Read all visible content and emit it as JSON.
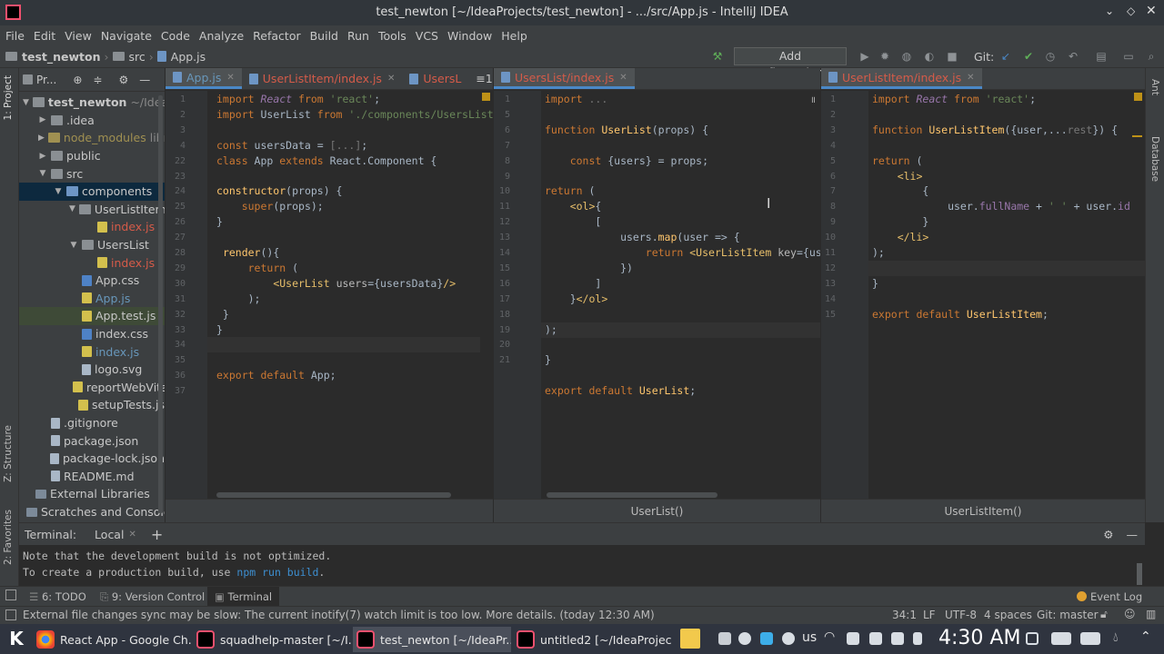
{
  "window": {
    "title": "test_newton [~/IdeaProjects/test_newton] - .../src/App.js - IntelliJ IDEA"
  },
  "menu": [
    "File",
    "Edit",
    "View",
    "Navigate",
    "Code",
    "Analyze",
    "Refactor",
    "Build",
    "Run",
    "Tools",
    "VCS",
    "Window",
    "Help"
  ],
  "breadcrumb": {
    "project": "test_newton",
    "folder": "src",
    "file": "App.js"
  },
  "toolbar": {
    "run_config": "Add Configuration...",
    "git_label": "Git:"
  },
  "left_tools": {
    "project": "1: Project",
    "structure": "Z: Structure",
    "favorites": "2: Favorites"
  },
  "right_tools": {
    "ant": "Ant",
    "database": "Database"
  },
  "project": {
    "title": "Pr...",
    "items": [
      {
        "name": "test_newton",
        "suffix": "~/IdeaP",
        "depth": 0,
        "icon": "folder",
        "open": true,
        "bold": true
      },
      {
        "name": ".idea",
        "depth": 1,
        "icon": "folder",
        "open": false
      },
      {
        "name": "node_modules",
        "suffix": "libr",
        "depth": 1,
        "icon": "folder-yellow",
        "open": false,
        "style": "yellow"
      },
      {
        "name": "public",
        "depth": 1,
        "icon": "folder",
        "open": false
      },
      {
        "name": "src",
        "depth": 1,
        "icon": "folder",
        "open": true
      },
      {
        "name": "components",
        "depth": 2,
        "icon": "folder-blue",
        "open": true,
        "selected": true
      },
      {
        "name": "UserListItem",
        "depth": 3,
        "icon": "folder",
        "open": true
      },
      {
        "name": "index.js",
        "depth": 4,
        "icon": "js",
        "style": "red"
      },
      {
        "name": "UsersList",
        "depth": 3,
        "icon": "folder",
        "open": true
      },
      {
        "name": "index.js",
        "depth": 4,
        "icon": "js",
        "style": "red"
      },
      {
        "name": "App.css",
        "depth": 3,
        "icon": "css"
      },
      {
        "name": "App.js",
        "depth": 3,
        "icon": "js",
        "style": "blue"
      },
      {
        "name": "App.test.js",
        "depth": 3,
        "icon": "js",
        "highlight": true
      },
      {
        "name": "index.css",
        "depth": 3,
        "icon": "css"
      },
      {
        "name": "index.js",
        "depth": 3,
        "icon": "js",
        "style": "blue"
      },
      {
        "name": "logo.svg",
        "depth": 3,
        "icon": "file"
      },
      {
        "name": "reportWebVitals",
        "depth": 3,
        "icon": "js"
      },
      {
        "name": "setupTests.js",
        "depth": 3,
        "icon": "js"
      },
      {
        "name": ".gitignore",
        "depth": 1,
        "icon": "file"
      },
      {
        "name": "package.json",
        "depth": 1,
        "icon": "file"
      },
      {
        "name": "package-lock.json",
        "depth": 1,
        "icon": "file"
      },
      {
        "name": "README.md",
        "depth": 1,
        "icon": "file"
      },
      {
        "name": "External Libraries",
        "depth": 0,
        "icon": "lib"
      },
      {
        "name": "Scratches and Console",
        "depth": 0,
        "icon": "lib"
      }
    ]
  },
  "editor1": {
    "tabs": [
      "App.js",
      "UserListItem/index.js",
      "UsersL"
    ],
    "tab_overflow": "≡1",
    "lines": [
      "1",
      "2",
      "3",
      "4",
      "22",
      "23",
      "24",
      "25",
      "26",
      "27",
      "28",
      "29",
      "30",
      "31",
      "32",
      "33",
      "34",
      "35",
      "36",
      "37"
    ],
    "code": [
      [
        {
          "c": "kw",
          "t": "import "
        },
        {
          "c": "it",
          "t": "React"
        },
        {
          "c": "kw",
          "t": " from "
        },
        {
          "c": "str",
          "t": "'react'"
        },
        {
          "t": ";"
        }
      ],
      [
        {
          "c": "kw",
          "t": "import "
        },
        {
          "t": "UserList "
        },
        {
          "c": "kw",
          "t": "from "
        },
        {
          "c": "str",
          "t": "'./components/UsersList'"
        },
        {
          "t": ";"
        }
      ],
      [],
      [
        {
          "c": "kw",
          "t": "const "
        },
        {
          "t": "usersData = "
        },
        {
          "c": "dim",
          "t": "[...]"
        },
        {
          "t": ";"
        }
      ],
      [
        {
          "c": "kw",
          "t": "class "
        },
        {
          "t": "App "
        },
        {
          "c": "kw",
          "t": "extends "
        },
        {
          "t": "React.Component {"
        }
      ],
      [],
      [
        {
          "c": "fn",
          "t": "constructor"
        },
        {
          "t": "(props) {"
        }
      ],
      [
        {
          "t": "    "
        },
        {
          "c": "kw",
          "t": "super"
        },
        {
          "t": "(props);"
        }
      ],
      [
        {
          "t": "}"
        }
      ],
      [],
      [
        {
          "t": " "
        },
        {
          "c": "fn",
          "t": "render"
        },
        {
          "t": "(){"
        }
      ],
      [
        {
          "t": "     "
        },
        {
          "c": "kw",
          "t": "return "
        },
        {
          "t": "("
        }
      ],
      [
        {
          "t": "         "
        },
        {
          "c": "tag",
          "t": "<UserList "
        },
        {
          "c": "attr",
          "t": "users"
        },
        {
          "t": "={usersData}"
        },
        {
          "c": "tag",
          "t": "/>"
        }
      ],
      [
        {
          "t": "     );"
        }
      ],
      [
        {
          "t": " }"
        }
      ],
      [
        {
          "t": "}"
        }
      ],
      [],
      [],
      [
        {
          "c": "kw",
          "t": "export default "
        },
        {
          "t": "App;"
        }
      ],
      []
    ]
  },
  "editor2": {
    "tab": "UsersList/index.js",
    "lines": [
      "1",
      "5",
      "6",
      "7",
      "8",
      "9",
      "10",
      "11",
      "12",
      "13",
      "14",
      "15",
      "16",
      "17",
      "18",
      "19",
      "20",
      "21"
    ],
    "code": [
      [
        {
          "c": "kw",
          "t": "import "
        },
        {
          "c": "dim",
          "t": "..."
        }
      ],
      [],
      [
        {
          "c": "kw",
          "t": "function "
        },
        {
          "c": "fn",
          "t": "UserList"
        },
        {
          "t": "(props) {"
        }
      ],
      [],
      [
        {
          "t": "    "
        },
        {
          "c": "kw",
          "t": "const "
        },
        {
          "t": "{users} = props;"
        }
      ],
      [],
      [
        {
          "c": "kw",
          "t": "return "
        },
        {
          "t": "("
        }
      ],
      [
        {
          "t": "    "
        },
        {
          "c": "tag",
          "t": "<ol>"
        },
        {
          "t": "{"
        }
      ],
      [
        {
          "t": "        ["
        }
      ],
      [
        {
          "t": "            users."
        },
        {
          "c": "fn",
          "t": "map"
        },
        {
          "t": "(user => {"
        }
      ],
      [
        {
          "t": "                "
        },
        {
          "c": "kw",
          "t": "return "
        },
        {
          "c": "tag",
          "t": "<UserListItem "
        },
        {
          "c": "attr",
          "t": "key"
        },
        {
          "t": "={user"
        }
      ],
      [
        {
          "t": "            })"
        }
      ],
      [
        {
          "t": "        ]"
        }
      ],
      [
        {
          "t": "    }"
        },
        {
          "c": "tag",
          "t": "</ol>"
        }
      ],
      [],
      [
        {
          "t": ");"
        }
      ],
      [],
      [
        {
          "t": "}"
        }
      ],
      [],
      [
        {
          "c": "kw",
          "t": "export default "
        },
        {
          "c": "fn",
          "t": "UserList"
        },
        {
          "t": ";"
        }
      ]
    ],
    "crumb": "UserList()"
  },
  "editor3": {
    "tab": "UserListItem/index.js",
    "lines": [
      "1",
      "2",
      "3",
      "4",
      "5",
      "6",
      "7",
      "8",
      "9",
      "10",
      "11",
      "12",
      "13",
      "14",
      "15"
    ],
    "code": [
      [
        {
          "c": "kw",
          "t": "import "
        },
        {
          "c": "it",
          "t": "React"
        },
        {
          "c": "kw",
          "t": " from "
        },
        {
          "c": "str",
          "t": "'react'"
        },
        {
          "t": ";"
        }
      ],
      [],
      [
        {
          "c": "kw",
          "t": "function "
        },
        {
          "c": "fn",
          "t": "UserListItem"
        },
        {
          "t": "({user,..."
        },
        {
          "c": "dim",
          "t": "rest"
        },
        {
          "t": "}) {"
        }
      ],
      [],
      [
        {
          "c": "kw",
          "t": "return "
        },
        {
          "t": "("
        }
      ],
      [
        {
          "t": "    "
        },
        {
          "c": "tag",
          "t": "<li>"
        }
      ],
      [
        {
          "t": "        {"
        }
      ],
      [
        {
          "t": "            user."
        },
        {
          "c": "pur",
          "t": "fullName"
        },
        {
          "t": " + "
        },
        {
          "c": "str",
          "t": "' '"
        },
        {
          "t": " + user."
        },
        {
          "c": "pur",
          "t": "id"
        }
      ],
      [
        {
          "t": "        }"
        }
      ],
      [
        {
          "t": "    "
        },
        {
          "c": "tag",
          "t": "</li>"
        }
      ],
      [
        {
          "t": ");"
        }
      ],
      [],
      [
        {
          "t": "}"
        }
      ],
      [],
      [
        {
          "c": "kw",
          "t": "export default "
        },
        {
          "c": "fn",
          "t": "UserListItem"
        },
        {
          "t": ";"
        }
      ]
    ],
    "crumb": "UserListItem()"
  },
  "terminal": {
    "title": "Terminal:",
    "tab": "Local",
    "line1": "Note that the development build is not optimized.",
    "line2_prefix": "To create a production build, use ",
    "line2_cmd": "npm run build",
    "line2_suffix": "."
  },
  "toolwindows": {
    "todo": "6: TODO",
    "vcs": "9: Version Control",
    "terminal": "Terminal",
    "event_log": "Event Log"
  },
  "status": {
    "message": "External file changes sync may be slow: The current inotify(7) watch limit is too low. More details. (today 12:30 AM)",
    "position": "34:1",
    "line_sep": "LF",
    "encoding": "UTF-8",
    "indent": "4 spaces",
    "git": "Git: master"
  },
  "taskbar": {
    "tasks": [
      "React App - Google Ch...",
      "squadhelp-master [~/I...",
      "test_newton [~/IdeaPr...",
      "untitled2 [~/IdeaProjec..."
    ],
    "keyboard": "us",
    "clock": "4:30 AM"
  }
}
